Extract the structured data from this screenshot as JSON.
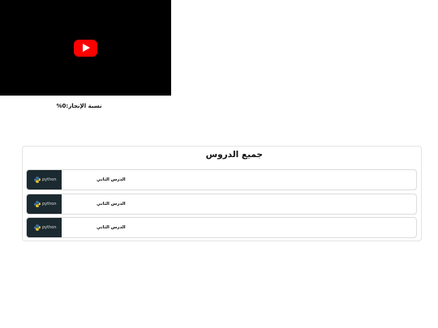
{
  "video": {
    "play_icon": "youtube-play-icon",
    "brand_color": "#ff0000"
  },
  "progress": {
    "label": "نسبة الإنجاز:0%",
    "value_percent": 0
  },
  "lessons_panel": {
    "title": "جميع الدروس",
    "lessons": [
      {
        "title": "الدرس الثاني",
        "thumbnail_text": "python"
      },
      {
        "title": "الدرس الثاني",
        "thumbnail_text": "python"
      },
      {
        "title": "الدرس الثاني",
        "thumbnail_text": "python"
      }
    ]
  }
}
